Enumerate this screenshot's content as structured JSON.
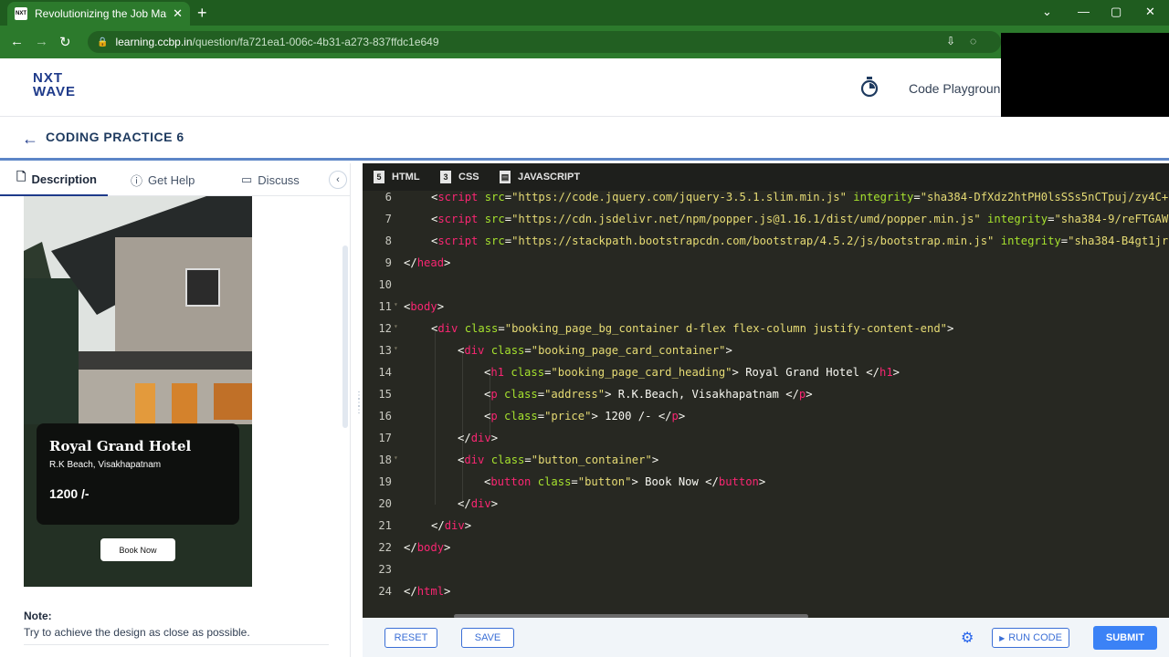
{
  "browser": {
    "tab_title": "Revolutionizing the Job Market |",
    "favicon_text": "NXT",
    "close_glyph": "✕",
    "new_tab_glyph": "+",
    "url_host": "learning.ccbp.in",
    "url_path": "/question/fa721ea1-006c-4b31-a273-837ffdc1e649"
  },
  "header": {
    "logo_line1": "NXT",
    "logo_line2": "WAVE",
    "playground_label": "Code Playground"
  },
  "practice": {
    "title": "CODING PRACTICE 6"
  },
  "left_tabs": [
    {
      "label": "Description",
      "icon": "document-icon"
    },
    {
      "label": "Get Help",
      "icon": "help-icon"
    },
    {
      "label": "Discuss",
      "icon": "chat-icon"
    }
  ],
  "preview": {
    "heading": "Royal Grand Hotel",
    "address": "R.K Beach, Visakhapatnam",
    "price": "1200 /-",
    "button": "Book Now"
  },
  "note": {
    "label": "Note:",
    "text": "Try to achieve the design as close as possible."
  },
  "editor_tabs": [
    "HTML",
    "CSS",
    "JAVASCRIPT"
  ],
  "code_lines": [
    {
      "n": "6"
    },
    {
      "n": "7"
    },
    {
      "n": "8"
    },
    {
      "n": "9"
    },
    {
      "n": "10"
    },
    {
      "n": "11"
    },
    {
      "n": "12"
    },
    {
      "n": "13"
    },
    {
      "n": "14"
    },
    {
      "n": "15"
    },
    {
      "n": "16"
    },
    {
      "n": "17"
    },
    {
      "n": "18"
    },
    {
      "n": "19"
    },
    {
      "n": "20"
    },
    {
      "n": "21"
    },
    {
      "n": "22"
    },
    {
      "n": "23"
    },
    {
      "n": "24"
    }
  ],
  "code_text": {
    "l6_src": "\"https://code.jquery.com/jquery-3.5.1.slim.min.js\"",
    "l6_int": "\"sha384-DfXdz2htPH0lsSSs5nCTpuj/zy4C+",
    "l7_src": "\"https://cdn.jsdelivr.net/npm/popper.js@1.16.1/dist/umd/popper.min.js\"",
    "l7_int": "\"sha384-9/reFTGAW",
    "l8_src": "\"https://stackpath.bootstrapcdn.com/bootstrap/4.5.2/js/bootstrap.min.js\"",
    "l8_int": "\"sha384-B4gt1jr",
    "l12_class": "\"booking_page_bg_container d-flex flex-column justify-content-end\"",
    "l13_class": "\"booking_page_card_container\"",
    "l14_class": "\"booking_page_card_heading\"",
    "l14_text": " Royal Grand Hotel ",
    "l15_class": "\"address\"",
    "l15_text": " R.K.Beach, Visakhapatnam ",
    "l16_class": "\"price\"",
    "l16_text": " 1200 /- ",
    "l18_class": "\"button_container\"",
    "l19_class": "\"button\"",
    "l19_text": " Book Now "
  },
  "bottom": {
    "reset": "RESET",
    "save": "SAVE",
    "run": "RUN CODE",
    "submit": "SUBMIT"
  }
}
